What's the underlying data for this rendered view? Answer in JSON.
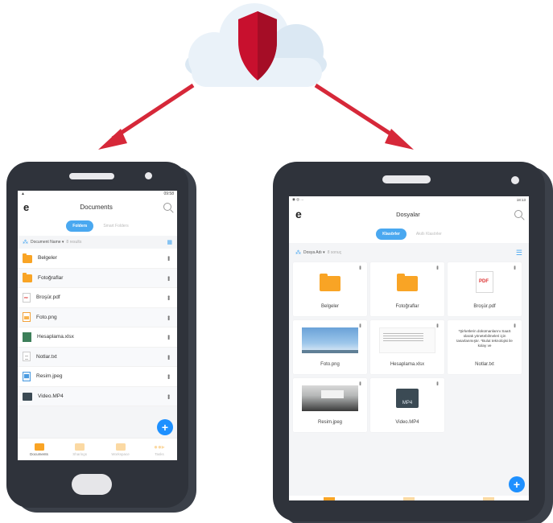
{
  "colors": {
    "accent": "#4aa8f0",
    "fab": "#1e90ff",
    "folder": "#f9a425",
    "shield": "#c8102e",
    "arrow": "#d62839",
    "frame": "#2f333b"
  },
  "cloud": {
    "icon": "shield-icon"
  },
  "phone_small": {
    "status": {
      "left": "▲",
      "right": "09:58"
    },
    "app_title": "Documents",
    "logo": "e",
    "tabs": [
      {
        "label": "Folders",
        "active": true
      },
      {
        "label": "Smart Folders",
        "active": false
      }
    ],
    "sort_label": "Document Name ▾",
    "result_count": "8 results",
    "files": [
      {
        "name": "Belgeler",
        "icon": "folder-icon"
      },
      {
        "name": "Fotoğraflar",
        "icon": "folder-icon"
      },
      {
        "name": "Broşür.pdf",
        "icon": "pdf-file-icon"
      },
      {
        "name": "Foto.png",
        "icon": "image-file-icon"
      },
      {
        "name": "Hesaplama.xlsx",
        "icon": "spreadsheet-file-icon"
      },
      {
        "name": "Notlar.txt",
        "icon": "text-file-icon"
      },
      {
        "name": "Resim.jpeg",
        "icon": "jpeg-file-icon"
      },
      {
        "name": "Video.MP4",
        "icon": "video-file-icon"
      }
    ],
    "fab": "+",
    "nav": [
      {
        "label": "Documents",
        "active": true
      },
      {
        "label": "Sharings",
        "active": false
      },
      {
        "label": "Workspace",
        "active": false
      },
      {
        "label": "Tasks",
        "active": false
      }
    ]
  },
  "phone_large": {
    "status": {
      "left": "◉ ◎ ...",
      "right": "18:13"
    },
    "app_title": "Dosyalar",
    "logo": "e",
    "tabs": [
      {
        "label": "Klasörler",
        "active": true
      },
      {
        "label": "Akıllı Klasörler",
        "active": false
      }
    ],
    "sort_label": "Dosya Adı ▾",
    "result_count": "8 sonuç",
    "files": [
      {
        "name": "Belgeler",
        "preview": "folder"
      },
      {
        "name": "Fotoğraflar",
        "preview": "folder"
      },
      {
        "name": "Broşür.pdf",
        "preview": "pdf",
        "badge": "PDF"
      },
      {
        "name": "Foto.png",
        "preview": "sky"
      },
      {
        "name": "Hesaplama.xlsx",
        "preview": "sheet"
      },
      {
        "name": "Notlar.txt",
        "preview": "text",
        "text": "*Şirketlerin dokümanlarını SaaS olarak yönetebilmeleri için tasarlanmıştır. *Bulut teknolojisi ile kolay ve"
      },
      {
        "name": "Resim.jpeg",
        "preview": "dark"
      },
      {
        "name": "Video.MP4",
        "preview": "video",
        "badge": "MP4"
      }
    ],
    "fab": "+"
  }
}
